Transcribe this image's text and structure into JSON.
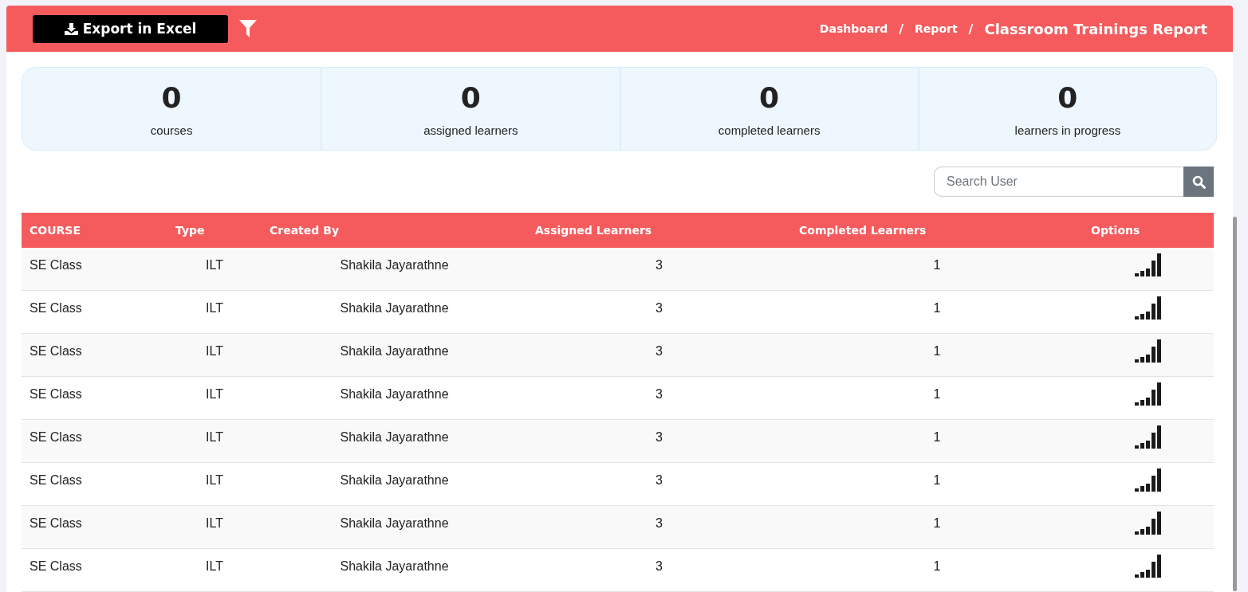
{
  "toolbar": {
    "export_button": "Export in Excel"
  },
  "breadcrumb": [
    {
      "label": "Dashboard",
      "separator": "/"
    },
    {
      "label": "Report",
      "separator": "/"
    }
  ],
  "page_title": "Classroom Trainings Report",
  "stats": [
    {
      "value": "0",
      "label": "courses"
    },
    {
      "value": "0",
      "label": "assigned learners"
    },
    {
      "value": "0",
      "label": "completed learners"
    },
    {
      "value": "0",
      "label": "learners in progress"
    }
  ],
  "search": {
    "placeholder": "Search User"
  },
  "table": {
    "columns": [
      "COURSE",
      "Type",
      "Created By",
      "Assigned Learners",
      "Completed Learners",
      "Options"
    ],
    "rows": [
      [
        "SE Class",
        "ILT",
        "Shakila Jayarathne",
        "3",
        "1"
      ],
      [
        "SE Class",
        "ILT",
        "Shakila Jayarathne",
        "3",
        "1"
      ],
      [
        "SE Class",
        "ILT",
        "Shakila Jayarathne",
        "3",
        "1"
      ],
      [
        "SE Class",
        "ILT",
        "Shakila Jayarathne",
        "3",
        "1"
      ],
      [
        "SE Class",
        "ILT",
        "Shakila Jayarathne",
        "3",
        "1"
      ],
      [
        "SE Class",
        "ILT",
        "Shakila Jayarathne",
        "3",
        "1"
      ],
      [
        "SE Class",
        "ILT",
        "Shakila Jayarathne",
        "3",
        "1"
      ],
      [
        "SE Class",
        "ILT",
        "Shakila Jayarathne",
        "3",
        "1"
      ]
    ]
  }
}
